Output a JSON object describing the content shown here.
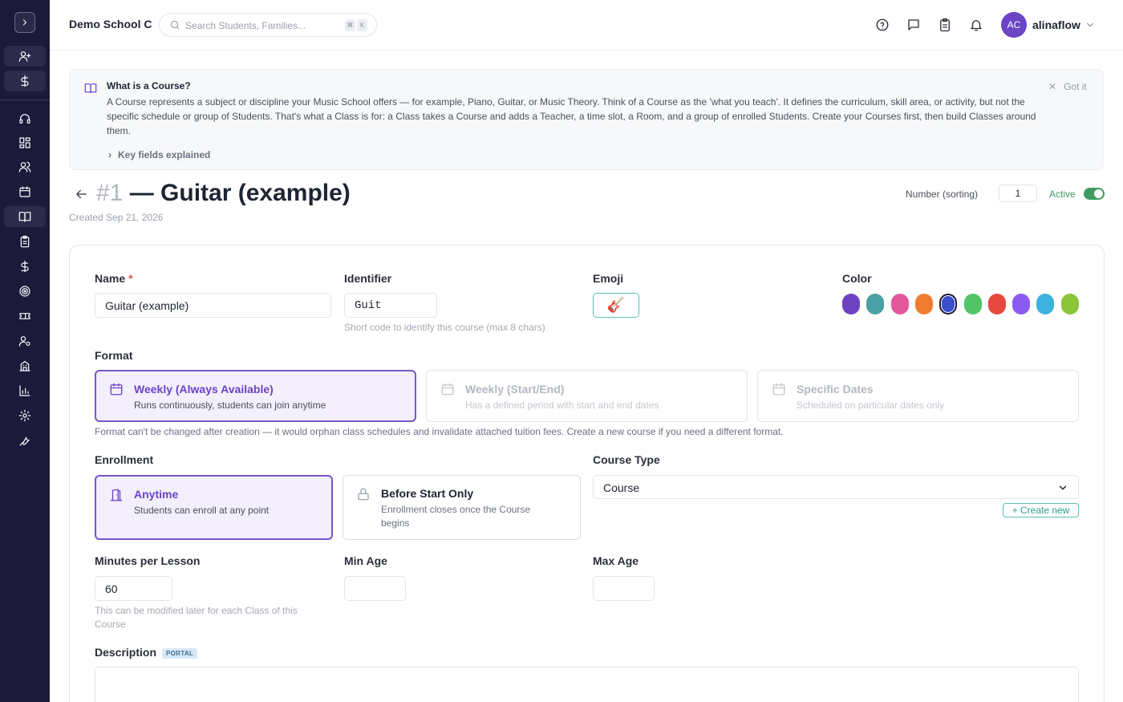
{
  "topbar": {
    "school_name": "Demo School C",
    "search_placeholder": "Search Students, Families...",
    "shortcut_keys": [
      "⌘",
      "K"
    ],
    "user_initials": "AC",
    "username": "alinaflow",
    "accent_color": "#6a44c5"
  },
  "sidebar": {
    "icons": [
      "user-plus-icon",
      "dollar-icon",
      "headset-icon",
      "dashboard-icon",
      "users-icon",
      "calendar-icon",
      "book-icon",
      "clipboard-icon",
      "dollar-icon",
      "target-icon",
      "ticket-icon",
      "user-cog-icon",
      "building-icon",
      "chart-icon",
      "settings-icon",
      "wrench-icon"
    ],
    "active": "book-icon"
  },
  "banner": {
    "title": "What is a Course?",
    "text": "A Course represents a subject or discipline your Music School offers — for example, Piano, Guitar, or Music Theory. Think of a Course as the 'what you teach'. It defines the curriculum, skill area, or activity, but not the specific schedule or group of Students. That's what a Class is for: a Class takes a Course and adds a Teacher, a time slot, a Room, and a group of enrolled Students. Create your Courses first, then build Classes around them.",
    "dismiss_label": "Got it",
    "key_fields_label": "Key fields explained"
  },
  "header": {
    "number_prefix": "#1",
    "title": " — Guitar (example)",
    "created": "Created Sep 21, 2026",
    "number_label": "Number (sorting)",
    "number_value": "1",
    "active_label": "Active",
    "active": true
  },
  "form": {
    "name_label": "Name",
    "name_required": "*",
    "name_value": "Guitar (example)",
    "identifier_label": "Identifier",
    "identifier_value": "Guit",
    "identifier_hint": "Short code to identify this course (max 8 chars)",
    "emoji_label": "Emoji",
    "emoji_value": "🎸",
    "color_label": "Color",
    "colors": [
      "#6f42c1",
      "#4aa0a4",
      "#e2599c",
      "#ef7d31",
      "#3a4fc9",
      "#52c467",
      "#e5483f",
      "#8a5cf2",
      "#3db2dd",
      "#8bc43b"
    ],
    "selected_color": "#3a4fc9",
    "format_label": "Format",
    "formats": [
      {
        "title": "Weekly (Always Available)",
        "desc": "Runs continuously, students can join anytime",
        "selected": true
      },
      {
        "title": "Weekly (Start/End)",
        "desc": "Has a defined period with start and end dates",
        "selected": false
      },
      {
        "title": "Specific Dates",
        "desc": "Scheduled on particular dates only",
        "selected": false
      }
    ],
    "format_note": "Format can't be changed after creation — it would orphan class schedules and invalidate attached tuition fees. Create a new course if you need a different format.",
    "enrollment_label": "Enrollment",
    "enrollment_options": [
      {
        "title": "Anytime",
        "desc": "Students can enroll at any point",
        "selected": true
      },
      {
        "title": "Before Start Only",
        "desc": "Enrollment closes once the Course begins",
        "selected": false
      }
    ],
    "course_type_label": "Course Type",
    "course_type_value": "Course",
    "create_new_label": "+ Create new",
    "minutes_label": "Minutes per Lesson",
    "minutes_value": "60",
    "minutes_hint": "This can be modified later for each Class of this Course",
    "min_age_label": "Min Age",
    "min_age_value": "",
    "max_age_label": "Max Age",
    "max_age_value": "",
    "description_label": "Description",
    "description_badge": "PORTAL"
  }
}
